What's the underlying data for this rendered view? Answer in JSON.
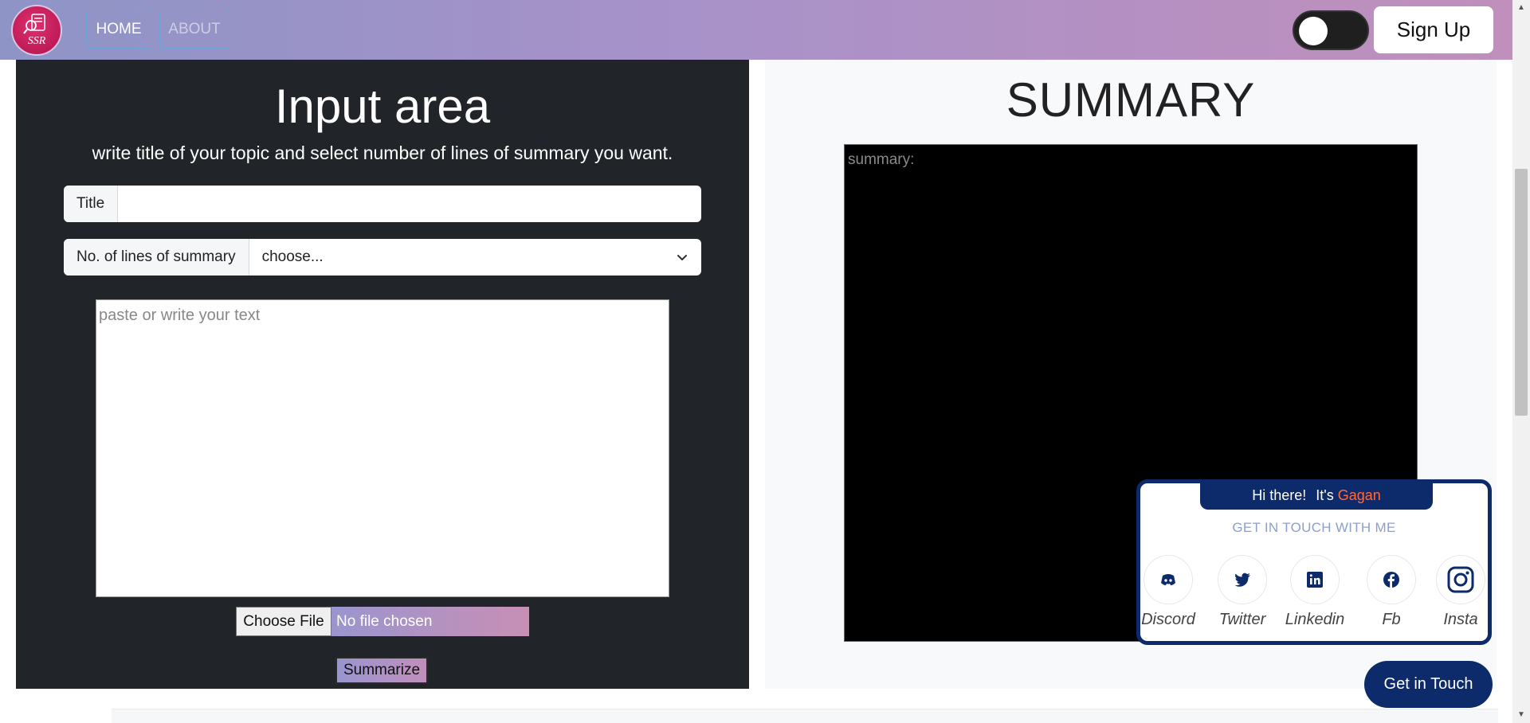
{
  "nav": {
    "logo_text": "SSR",
    "home_label": "HOME",
    "about_label": "ABOUT",
    "signup_label": "Sign Up"
  },
  "input_area": {
    "title": "Input area",
    "subtitle": "write title of your topic and select number of lines of summary you want.",
    "title_label": "Title",
    "title_value": "",
    "lines_label": "No. of lines of summary",
    "lines_selected": "choose...",
    "textarea_placeholder": "paste or write your text",
    "file_button": "Choose File",
    "file_status": "No file chosen",
    "summarize_label": "Summarize"
  },
  "summary_area": {
    "title": "SUMMARY",
    "placeholder": "summary:"
  },
  "contact": {
    "greeting": "Hi there!",
    "its": "It's",
    "name": "Gagan",
    "subtitle": "GET IN TOUCH WITH ME",
    "socials": [
      {
        "label": "Discord",
        "icon": "discord-icon"
      },
      {
        "label": "Twitter",
        "icon": "twitter-icon"
      },
      {
        "label": "Linkedin",
        "icon": "linkedin-icon"
      },
      {
        "label": "Fb",
        "icon": "facebook-icon"
      },
      {
        "label": "Insta",
        "icon": "instagram-icon"
      }
    ],
    "button_label": "Get in Touch"
  },
  "colors": {
    "nav_gradient_start": "#8e94c6",
    "nav_gradient_end": "#c08fbc",
    "dark_panel": "#212529",
    "contact_navy": "#0d2a6b",
    "name_accent": "#ff6a3d"
  }
}
